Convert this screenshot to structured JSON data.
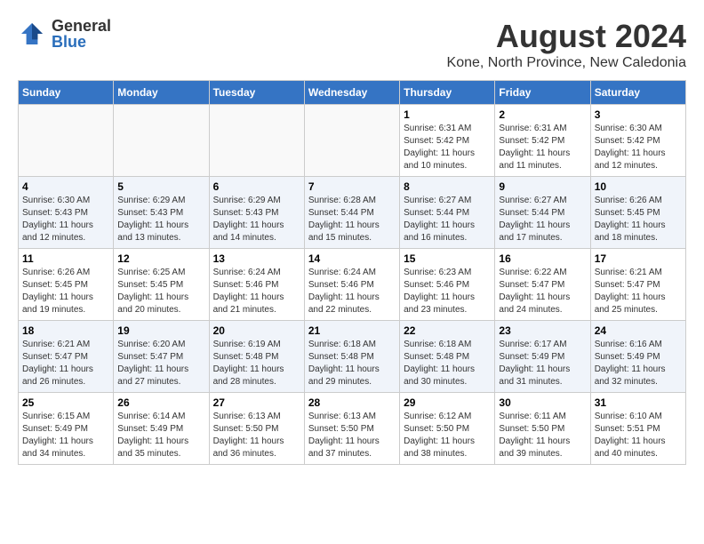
{
  "header": {
    "logo": {
      "general": "General",
      "blue": "Blue"
    },
    "month": "August 2024",
    "location": "Kone, North Province, New Caledonia"
  },
  "weekdays": [
    "Sunday",
    "Monday",
    "Tuesday",
    "Wednesday",
    "Thursday",
    "Friday",
    "Saturday"
  ],
  "weeks": [
    [
      {
        "day": "",
        "info": ""
      },
      {
        "day": "",
        "info": ""
      },
      {
        "day": "",
        "info": ""
      },
      {
        "day": "",
        "info": ""
      },
      {
        "day": "1",
        "info": "Sunrise: 6:31 AM\nSunset: 5:42 PM\nDaylight: 11 hours\nand 10 minutes."
      },
      {
        "day": "2",
        "info": "Sunrise: 6:31 AM\nSunset: 5:42 PM\nDaylight: 11 hours\nand 11 minutes."
      },
      {
        "day": "3",
        "info": "Sunrise: 6:30 AM\nSunset: 5:42 PM\nDaylight: 11 hours\nand 12 minutes."
      }
    ],
    [
      {
        "day": "4",
        "info": "Sunrise: 6:30 AM\nSunset: 5:43 PM\nDaylight: 11 hours\nand 12 minutes."
      },
      {
        "day": "5",
        "info": "Sunrise: 6:29 AM\nSunset: 5:43 PM\nDaylight: 11 hours\nand 13 minutes."
      },
      {
        "day": "6",
        "info": "Sunrise: 6:29 AM\nSunset: 5:43 PM\nDaylight: 11 hours\nand 14 minutes."
      },
      {
        "day": "7",
        "info": "Sunrise: 6:28 AM\nSunset: 5:44 PM\nDaylight: 11 hours\nand 15 minutes."
      },
      {
        "day": "8",
        "info": "Sunrise: 6:27 AM\nSunset: 5:44 PM\nDaylight: 11 hours\nand 16 minutes."
      },
      {
        "day": "9",
        "info": "Sunrise: 6:27 AM\nSunset: 5:44 PM\nDaylight: 11 hours\nand 17 minutes."
      },
      {
        "day": "10",
        "info": "Sunrise: 6:26 AM\nSunset: 5:45 PM\nDaylight: 11 hours\nand 18 minutes."
      }
    ],
    [
      {
        "day": "11",
        "info": "Sunrise: 6:26 AM\nSunset: 5:45 PM\nDaylight: 11 hours\nand 19 minutes."
      },
      {
        "day": "12",
        "info": "Sunrise: 6:25 AM\nSunset: 5:45 PM\nDaylight: 11 hours\nand 20 minutes."
      },
      {
        "day": "13",
        "info": "Sunrise: 6:24 AM\nSunset: 5:46 PM\nDaylight: 11 hours\nand 21 minutes."
      },
      {
        "day": "14",
        "info": "Sunrise: 6:24 AM\nSunset: 5:46 PM\nDaylight: 11 hours\nand 22 minutes."
      },
      {
        "day": "15",
        "info": "Sunrise: 6:23 AM\nSunset: 5:46 PM\nDaylight: 11 hours\nand 23 minutes."
      },
      {
        "day": "16",
        "info": "Sunrise: 6:22 AM\nSunset: 5:47 PM\nDaylight: 11 hours\nand 24 minutes."
      },
      {
        "day": "17",
        "info": "Sunrise: 6:21 AM\nSunset: 5:47 PM\nDaylight: 11 hours\nand 25 minutes."
      }
    ],
    [
      {
        "day": "18",
        "info": "Sunrise: 6:21 AM\nSunset: 5:47 PM\nDaylight: 11 hours\nand 26 minutes."
      },
      {
        "day": "19",
        "info": "Sunrise: 6:20 AM\nSunset: 5:47 PM\nDaylight: 11 hours\nand 27 minutes."
      },
      {
        "day": "20",
        "info": "Sunrise: 6:19 AM\nSunset: 5:48 PM\nDaylight: 11 hours\nand 28 minutes."
      },
      {
        "day": "21",
        "info": "Sunrise: 6:18 AM\nSunset: 5:48 PM\nDaylight: 11 hours\nand 29 minutes."
      },
      {
        "day": "22",
        "info": "Sunrise: 6:18 AM\nSunset: 5:48 PM\nDaylight: 11 hours\nand 30 minutes."
      },
      {
        "day": "23",
        "info": "Sunrise: 6:17 AM\nSunset: 5:49 PM\nDaylight: 11 hours\nand 31 minutes."
      },
      {
        "day": "24",
        "info": "Sunrise: 6:16 AM\nSunset: 5:49 PM\nDaylight: 11 hours\nand 32 minutes."
      }
    ],
    [
      {
        "day": "25",
        "info": "Sunrise: 6:15 AM\nSunset: 5:49 PM\nDaylight: 11 hours\nand 34 minutes."
      },
      {
        "day": "26",
        "info": "Sunrise: 6:14 AM\nSunset: 5:49 PM\nDaylight: 11 hours\nand 35 minutes."
      },
      {
        "day": "27",
        "info": "Sunrise: 6:13 AM\nSunset: 5:50 PM\nDaylight: 11 hours\nand 36 minutes."
      },
      {
        "day": "28",
        "info": "Sunrise: 6:13 AM\nSunset: 5:50 PM\nDaylight: 11 hours\nand 37 minutes."
      },
      {
        "day": "29",
        "info": "Sunrise: 6:12 AM\nSunset: 5:50 PM\nDaylight: 11 hours\nand 38 minutes."
      },
      {
        "day": "30",
        "info": "Sunrise: 6:11 AM\nSunset: 5:50 PM\nDaylight: 11 hours\nand 39 minutes."
      },
      {
        "day": "31",
        "info": "Sunrise: 6:10 AM\nSunset: 5:51 PM\nDaylight: 11 hours\nand 40 minutes."
      }
    ]
  ]
}
